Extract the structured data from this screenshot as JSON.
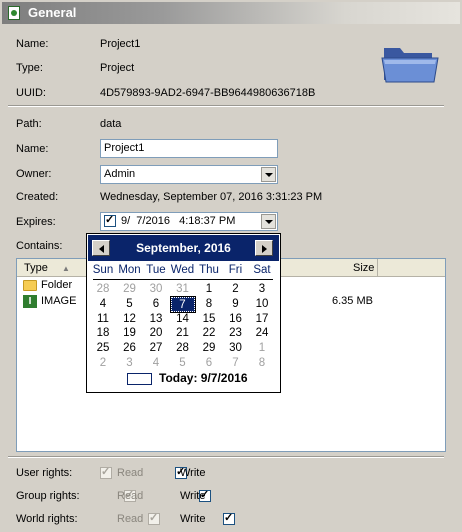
{
  "header": {
    "title": "General",
    "icon": "document-icon"
  },
  "info": {
    "name_label": "Name:",
    "name_value": "Project1",
    "type_label": "Type:",
    "type_value": "Project",
    "uuid_label": "UUID:",
    "uuid_value": "4D579893-9AD2-6947-BB9644980636718B"
  },
  "details": {
    "path_label": "Path:",
    "path_value": "data",
    "name_label": "Name:",
    "name_value": "Project1",
    "owner_label": "Owner:",
    "owner_value": "Admin",
    "created_label": "Created:",
    "created_value": "Wednesday, September 07, 2016 3:31:23 PM",
    "expires_label": "Expires:",
    "expires_value": "9/  7/2016   4:18:37 PM",
    "expires_checked": true,
    "contains_label": "Contains:"
  },
  "contents": {
    "columns": {
      "type": "Type",
      "size": "Size"
    },
    "rows": [
      {
        "name": "Folder",
        "icon": "folder-icon",
        "size": ""
      },
      {
        "name": "IMAGE",
        "icon": "image-icon",
        "size": "6.35 MB"
      }
    ]
  },
  "calendar": {
    "month_label": "September, 2016",
    "weekdays": [
      "Sun",
      "Mon",
      "Tue",
      "Wed",
      "Thu",
      "Fri",
      "Sat"
    ],
    "weeks": [
      [
        "28",
        "29",
        "30",
        "31",
        "1",
        "2",
        "3"
      ],
      [
        "4",
        "5",
        "6",
        "7",
        "8",
        "9",
        "10"
      ],
      [
        "11",
        "12",
        "13",
        "14",
        "15",
        "16",
        "17"
      ],
      [
        "18",
        "19",
        "20",
        "21",
        "22",
        "23",
        "24"
      ],
      [
        "25",
        "26",
        "27",
        "28",
        "29",
        "30",
        "1"
      ],
      [
        "2",
        "3",
        "4",
        "5",
        "6",
        "7",
        "8"
      ]
    ],
    "selected_day": "7",
    "today_label": "Today: 9/7/2016"
  },
  "rights": [
    {
      "label": "User rights:",
      "read_label": "Read",
      "write_label": "Write",
      "read": true,
      "write": true
    },
    {
      "label": "Group rights:",
      "read_label": "Read",
      "write_label": "Write",
      "read": true,
      "write": true
    },
    {
      "label": "World rights:",
      "read_label": "Read",
      "write_label": "Write",
      "read": true,
      "write": true
    }
  ],
  "colors": {
    "selection": "#0a246a",
    "panel": "#d4d0c8",
    "folder": "#f6cc52"
  }
}
